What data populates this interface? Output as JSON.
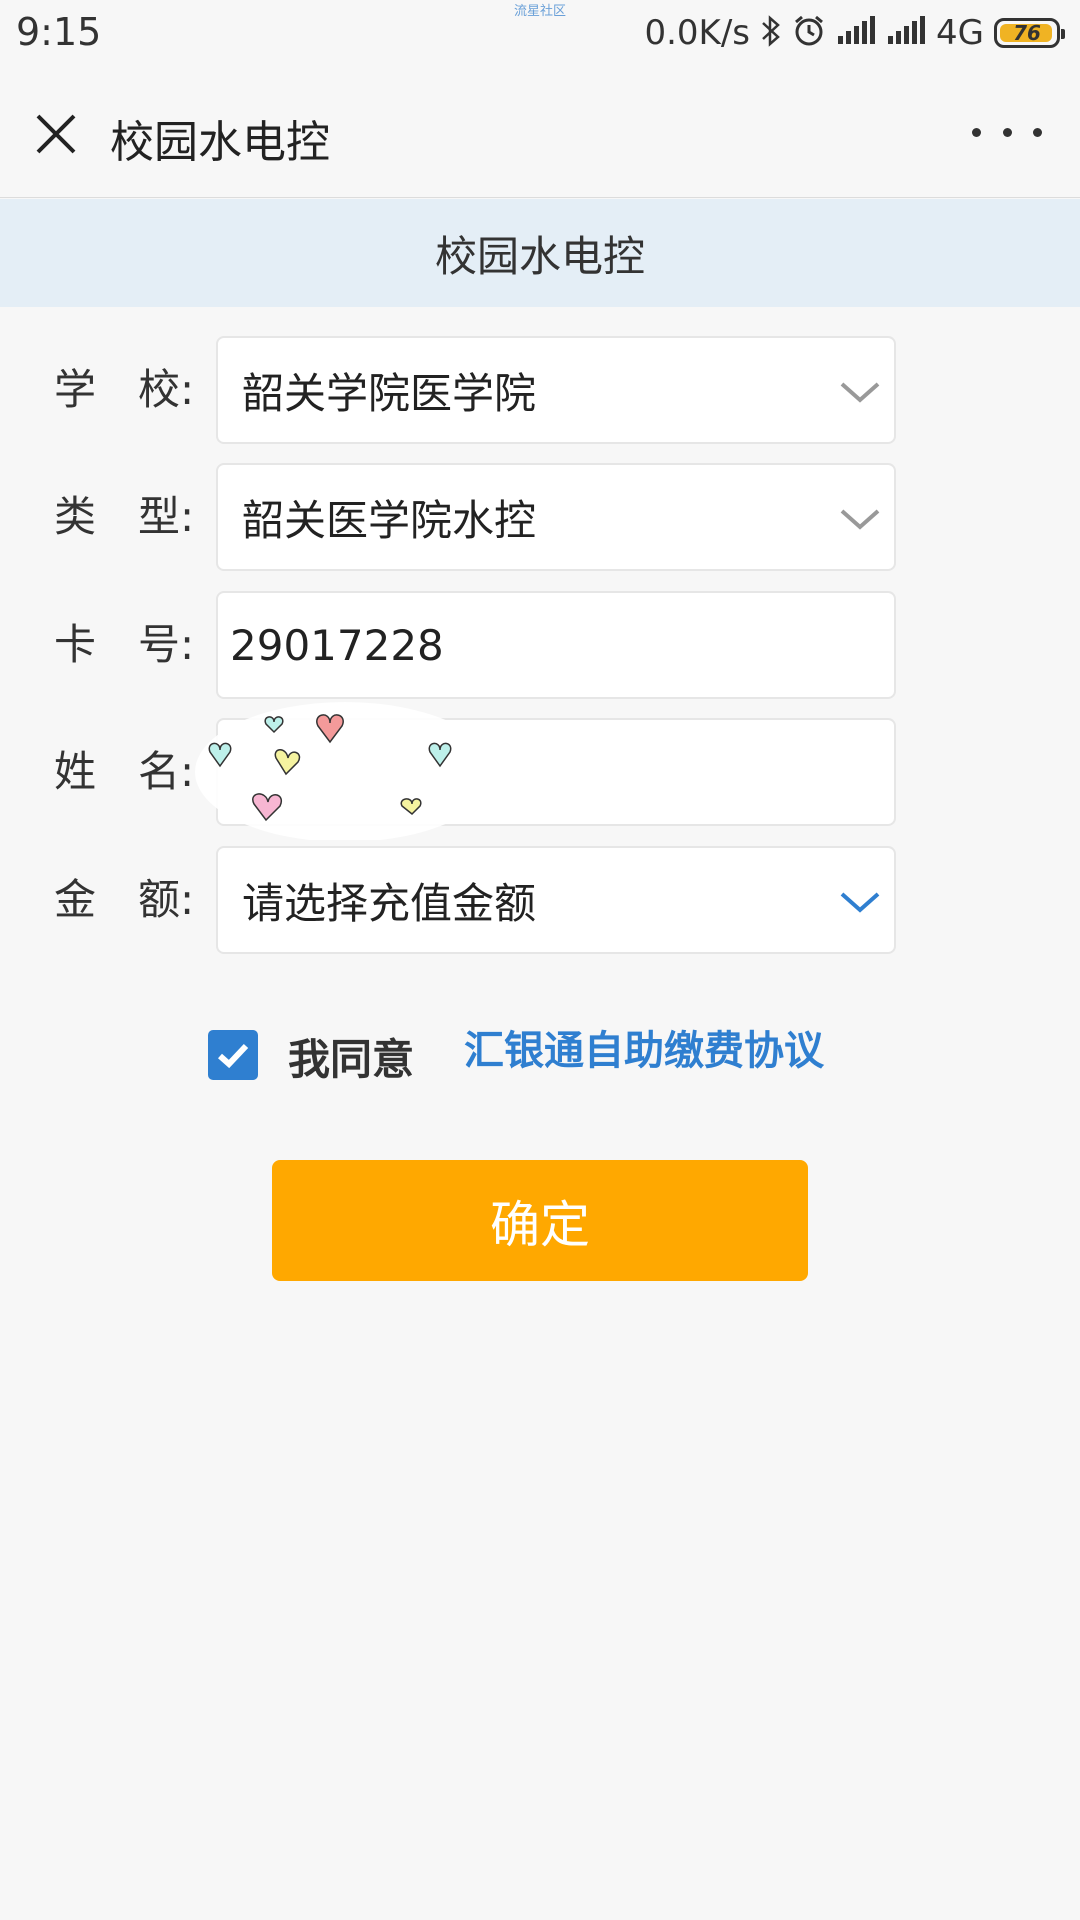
{
  "status_bar": {
    "time": "9:15",
    "watermark": "流星社区",
    "speed": "0.0K/s",
    "network": "4G",
    "battery": "76"
  },
  "title_bar": {
    "title": "校园水电控"
  },
  "banner": {
    "title": "校园水电控"
  },
  "form": {
    "school": {
      "label": "学　校:",
      "value": "韶关学院医学院"
    },
    "type": {
      "label": "类　型:",
      "value": "韶关医学院水控"
    },
    "card": {
      "label": "卡　号:",
      "value": "29017228"
    },
    "name": {
      "label": "姓　名:",
      "value": ""
    },
    "amount": {
      "label": "金　额:",
      "placeholder": "请选择充值金额"
    }
  },
  "agreement": {
    "checked": true,
    "text": "我同意",
    "link": "汇银通自助缴费协议"
  },
  "confirm_button": {
    "label": "确定"
  },
  "colors": {
    "accent_blue": "#2f7fd0",
    "confirm_orange": "#ffa800",
    "banner_bg": "#e4eef6",
    "battery_fill": "#f0b323"
  }
}
